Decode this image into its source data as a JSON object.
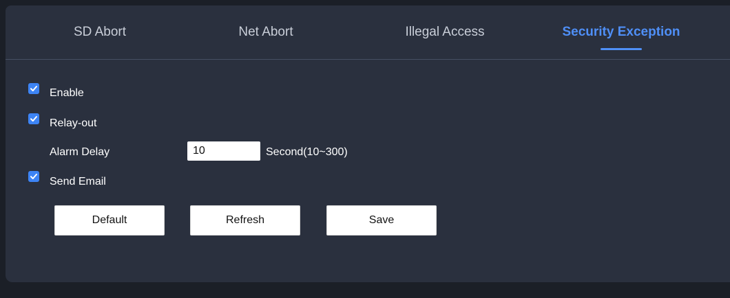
{
  "tabs": [
    {
      "label": "SD Abort",
      "active": false
    },
    {
      "label": "Net Abort",
      "active": false
    },
    {
      "label": "Illegal Access",
      "active": false
    },
    {
      "label": "Security Exception",
      "active": true
    }
  ],
  "form": {
    "enable": {
      "label": "Enable",
      "checked": true
    },
    "relay_out": {
      "label": "Relay-out",
      "checked": true
    },
    "alarm_delay": {
      "label": "Alarm Delay",
      "value": "10",
      "unit": "Second(10~300)"
    },
    "send_email": {
      "label": "Send Email",
      "checked": true
    }
  },
  "buttons": {
    "default_label": "Default",
    "refresh_label": "Refresh",
    "save_label": "Save"
  },
  "colors": {
    "background": "#2a303e",
    "page": "#1b1f27",
    "accent": "#4f8ff7",
    "checkbox": "#3d84f5",
    "text": "#ffffff",
    "tab_text": "#c9ced8"
  },
  "icons": {
    "checkbox_mark": "check-icon"
  }
}
